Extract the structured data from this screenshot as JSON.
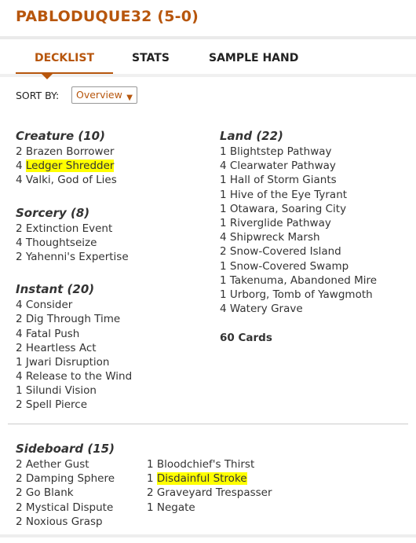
{
  "deck": {
    "title": "PABLODUQUE32 (5-0)"
  },
  "tabs": [
    {
      "label": "DECKLIST",
      "active": true
    },
    {
      "label": "STATS",
      "active": false
    },
    {
      "label": "SAMPLE HAND",
      "active": false
    }
  ],
  "sort": {
    "label": "SORT BY:",
    "selected": "Overview",
    "icon": "chevron-down-icon"
  },
  "creature": {
    "title": "Creature (10)",
    "cards": [
      {
        "qty": "2",
        "name": "Brazen Borrower",
        "highlight": false
      },
      {
        "qty": "4",
        "name": "Ledger Shredder",
        "highlight": true
      },
      {
        "qty": "4",
        "name": "Valki, God of Lies",
        "highlight": false
      }
    ]
  },
  "sorcery": {
    "title": "Sorcery (8)",
    "cards": [
      {
        "qty": "2",
        "name": "Extinction Event"
      },
      {
        "qty": "4",
        "name": "Thoughtseize"
      },
      {
        "qty": "2",
        "name": "Yahenni's Expertise"
      }
    ]
  },
  "instant": {
    "title": "Instant (20)",
    "cards": [
      {
        "qty": "4",
        "name": "Consider"
      },
      {
        "qty": "2",
        "name": "Dig Through Time"
      },
      {
        "qty": "4",
        "name": "Fatal Push"
      },
      {
        "qty": "2",
        "name": "Heartless Act"
      },
      {
        "qty": "1",
        "name": "Jwari Disruption"
      },
      {
        "qty": "4",
        "name": "Release to the Wind"
      },
      {
        "qty": "1",
        "name": "Silundi Vision"
      },
      {
        "qty": "2",
        "name": "Spell Pierce"
      }
    ]
  },
  "land": {
    "title": "Land (22)",
    "cards": [
      {
        "qty": "1",
        "name": "Blightstep Pathway"
      },
      {
        "qty": "4",
        "name": "Clearwater Pathway"
      },
      {
        "qty": "1",
        "name": "Hall of Storm Giants"
      },
      {
        "qty": "1",
        "name": "Hive of the Eye Tyrant"
      },
      {
        "qty": "1",
        "name": "Otawara, Soaring City"
      },
      {
        "qty": "1",
        "name": "Riverglide Pathway"
      },
      {
        "qty": "4",
        "name": "Shipwreck Marsh"
      },
      {
        "qty": "2",
        "name": "Snow-Covered Island"
      },
      {
        "qty": "1",
        "name": "Snow-Covered Swamp"
      },
      {
        "qty": "1",
        "name": "Takenuma, Abandoned Mire"
      },
      {
        "qty": "1",
        "name": "Urborg, Tomb of Yawgmoth"
      },
      {
        "qty": "4",
        "name": "Watery Grave"
      }
    ]
  },
  "total": "60 Cards",
  "sideboard": {
    "title": "Sideboard (15)",
    "left": [
      {
        "qty": "2",
        "name": "Aether Gust"
      },
      {
        "qty": "2",
        "name": "Damping Sphere"
      },
      {
        "qty": "2",
        "name": "Go Blank"
      },
      {
        "qty": "2",
        "name": "Mystical Dispute"
      },
      {
        "qty": "2",
        "name": "Noxious Grasp"
      }
    ],
    "right": [
      {
        "qty": "1",
        "name": "Bloodchief's Thirst",
        "highlight": false
      },
      {
        "qty": "1",
        "name": "Disdainful Stroke",
        "highlight": true
      },
      {
        "qty": "2",
        "name": "Graveyard Trespasser",
        "highlight": false
      },
      {
        "qty": "1",
        "name": "Negate",
        "highlight": false
      }
    ]
  },
  "colors": {
    "accent": "#b7560d",
    "highlight": "#ffff00",
    "text": "#333333"
  }
}
